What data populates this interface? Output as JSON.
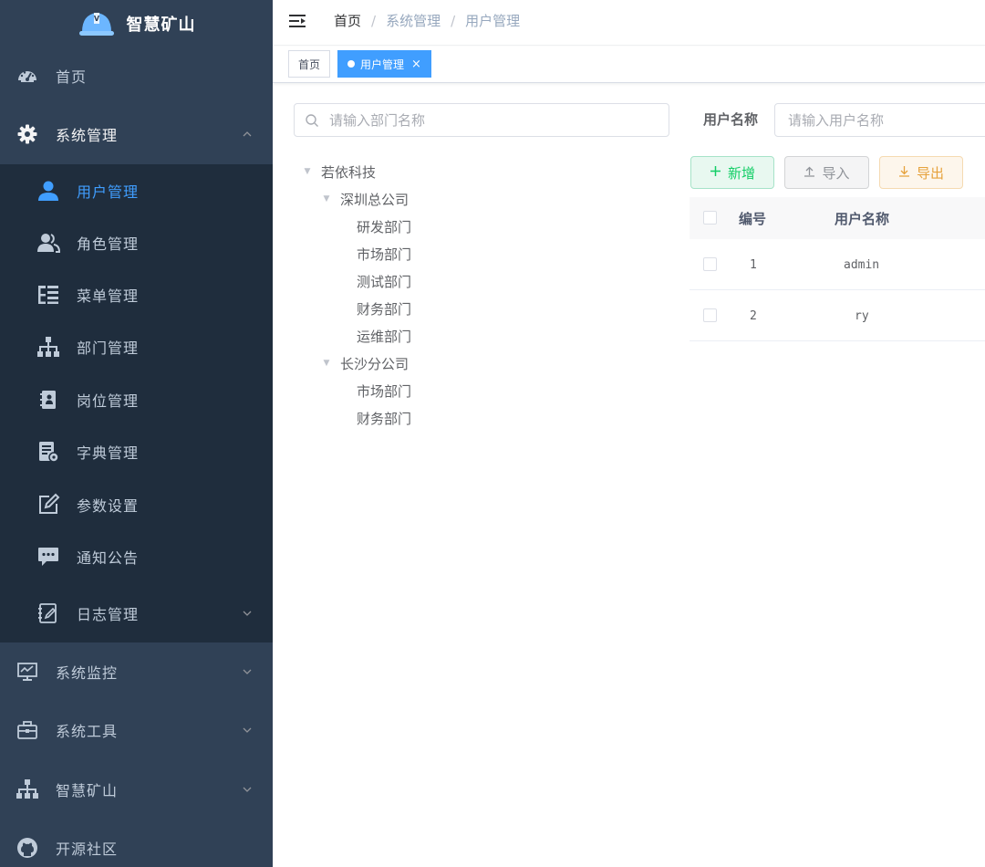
{
  "app": {
    "title": "智慧矿山"
  },
  "sidebar": {
    "items": [
      {
        "label": "首页",
        "icon": "dashboard-icon"
      },
      {
        "label": "系统管理",
        "icon": "gear-icon",
        "expanded": true
      },
      {
        "label": "系统监控",
        "icon": "monitor-icon"
      },
      {
        "label": "系统工具",
        "icon": "toolbox-icon"
      },
      {
        "label": "智慧矿山",
        "icon": "tree-icon"
      },
      {
        "label": "开源社区",
        "icon": "github-icon"
      }
    ],
    "submenu": [
      {
        "label": "用户管理",
        "icon": "user-icon",
        "active": true
      },
      {
        "label": "角色管理",
        "icon": "peoples-icon"
      },
      {
        "label": "菜单管理",
        "icon": "tree-table-icon"
      },
      {
        "label": "部门管理",
        "icon": "org-tree-icon"
      },
      {
        "label": "岗位管理",
        "icon": "post-icon"
      },
      {
        "label": "字典管理",
        "icon": "dict-icon"
      },
      {
        "label": "参数设置",
        "icon": "edit-icon"
      },
      {
        "label": "通知公告",
        "icon": "message-icon"
      },
      {
        "label": "日志管理",
        "icon": "log-icon"
      }
    ]
  },
  "breadcrumb": [
    "首页",
    "系统管理",
    "用户管理"
  ],
  "breadcrumb_sep": "/",
  "tags": [
    {
      "label": "首页",
      "active": false
    },
    {
      "label": "用户管理",
      "active": true
    }
  ],
  "tag_close": "×",
  "dept": {
    "search_placeholder": "请输入部门名称",
    "tree": [
      {
        "label": "若依科技",
        "level": 0,
        "expanded": true
      },
      {
        "label": "深圳总公司",
        "level": 1,
        "expanded": true
      },
      {
        "label": "研发部门",
        "level": 2
      },
      {
        "label": "市场部门",
        "level": 2
      },
      {
        "label": "测试部门",
        "level": 2
      },
      {
        "label": "财务部门",
        "level": 2
      },
      {
        "label": "运维部门",
        "level": 2
      },
      {
        "label": "长沙分公司",
        "level": 1,
        "expanded": true
      },
      {
        "label": "市场部门",
        "level": 2
      },
      {
        "label": "财务部门",
        "level": 2
      }
    ]
  },
  "query": {
    "username_label": "用户名称",
    "username_placeholder": "请输入用户名称"
  },
  "toolbar": {
    "add": "新增",
    "import": "导入",
    "export": "导出"
  },
  "table": {
    "headers": [
      "编号",
      "用户名称"
    ],
    "rows": [
      [
        "1",
        "admin"
      ],
      [
        "2",
        "ry"
      ]
    ]
  },
  "colors": {
    "sidebar_bg": "#304156",
    "submenu_bg": "#1f2d3d",
    "active": "#409eff",
    "success": "#13ce66",
    "warning": "#e6a23c"
  }
}
